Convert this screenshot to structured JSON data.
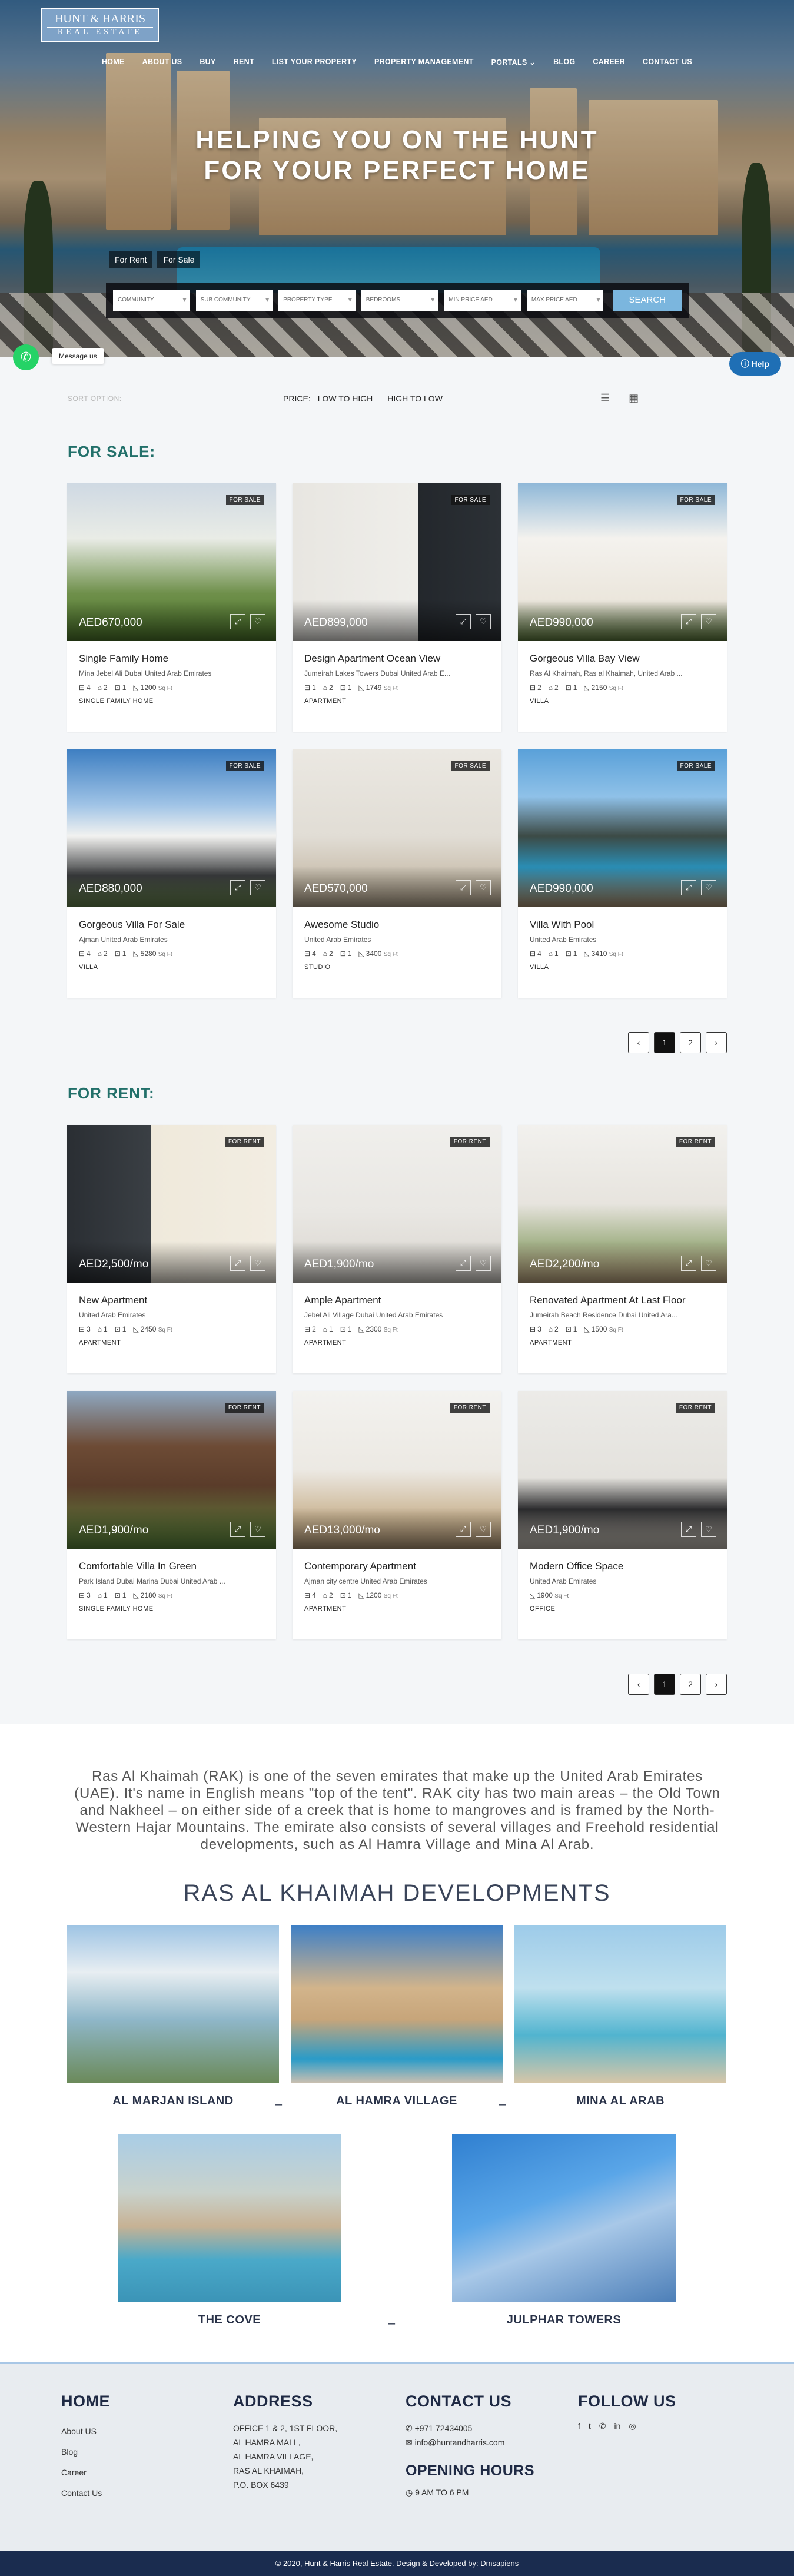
{
  "brand": {
    "line1": "HUNT & HARRIS",
    "line2": "REAL ESTATE"
  },
  "nav": [
    "HOME",
    "ABOUT US",
    "BUY",
    "RENT",
    "LIST YOUR PROPERTY",
    "PROPERTY MANAGEMENT",
    "PORTALS ⌄",
    "BLOG",
    "CAREER",
    "CONTACT US"
  ],
  "hero": {
    "title_line1": "HELPING YOU ON THE HUNT",
    "title_line2": "FOR YOUR PERFECT HOME",
    "tabs": [
      "For Rent",
      "For Sale"
    ],
    "filters": [
      "COMMUNITY",
      "SUB COMMUNITY",
      "PROPERTY TYPE",
      "BEDROOMS",
      "MIN PRICE AED",
      "MAX PRICE AED"
    ],
    "search_label": "SEARCH"
  },
  "widgets": {
    "whatsapp_label": "Message us",
    "help_label": "Help",
    "whatsapp_icon": "whatsapp-icon",
    "help_icon": "question-circle-icon"
  },
  "sort": {
    "label": "SORT OPTION:",
    "price_label": "PRICE:",
    "low_high": "LOW TO HIGH",
    "high_low": "HIGH TO LOW",
    "list_icon": "list-view-icon",
    "grid_icon": "grid-view-icon"
  },
  "sale": {
    "heading": "FOR SALE:",
    "listings": [
      {
        "badge": "FOR SALE",
        "price": "AED670,000",
        "title": "Single Family Home",
        "address": "Mina Jebel Ali Dubai United Arab Emirates",
        "beds": "4",
        "baths": "2",
        "garage": "1",
        "area": "1200",
        "unit": "Sq Ft",
        "type": "SINGLE FAMILY HOME",
        "bg": "linear-gradient(180deg,#cfd9e3 0%,#e9ece6 35%,#6e8f4a 70%,#4f7a2c 100%)"
      },
      {
        "badge": "FOR SALE",
        "price": "AED899,000",
        "title": "Design Apartment Ocean View",
        "address": "Jumeirah Lakes Towers Dubai United Arab E...",
        "beds": "1",
        "baths": "2",
        "garage": "1",
        "area": "1749",
        "unit": "Sq Ft",
        "type": "APARTMENT",
        "bg": "linear-gradient(90deg,#e8e6e1 0%,#efeeea 60%,#23272c 60%,#2c3136 100%)"
      },
      {
        "badge": "FOR SALE",
        "price": "AED990,000",
        "title": "Gorgeous Villa Bay View",
        "address": "Ras Al Khaimah, Ras al Khaimah, United Arab ...",
        "beds": "2",
        "baths": "2",
        "garage": "1",
        "area": "2150",
        "unit": "Sq Ft",
        "type": "VILLA",
        "bg": "linear-gradient(180deg,#8fb8d8 0%,#f4f2ee 35%,#ebe6dc 75%,#5f7d3d 100%)"
      },
      {
        "badge": "FOR SALE",
        "price": "AED880,000",
        "title": "Gorgeous Villa For Sale",
        "address": "Ajman United Arab Emirates",
        "beds": "4",
        "baths": "2",
        "garage": "1",
        "area": "5280",
        "unit": "Sq Ft",
        "type": "VILLA",
        "bg": "linear-gradient(180deg,#3e7fc2 0%,#9fc3e6 35%,#f2f2f0 55%,#3d3f41 80%,#6c8a52 100%)"
      },
      {
        "badge": "FOR SALE",
        "price": "AED570,000",
        "title": "Awesome Studio",
        "address": "United Arab Emirates",
        "beds": "4",
        "baths": "2",
        "garage": "1",
        "area": "3400",
        "unit": "Sq Ft",
        "type": "STUDIO",
        "bg": "linear-gradient(180deg,#ebe8e2 0%,#e1ddd5 55%,#cfc6b7 75%,#b9aa92 100%)"
      },
      {
        "badge": "FOR SALE",
        "price": "AED990,000",
        "title": "Villa With Pool",
        "address": "United Arab Emirates",
        "beds": "4",
        "baths": "1",
        "garage": "1",
        "area": "3410",
        "unit": "Sq Ft",
        "type": "VILLA",
        "bg": "linear-gradient(180deg,#5aa1d9 0%,#8fc1e8 30%,#3c4a45 55%,#2a8fb7 75%,#b79b78 100%)"
      }
    ],
    "pages": [
      "2"
    ]
  },
  "rent": {
    "heading": "FOR RENT:",
    "listings": [
      {
        "badge": "FOR RENT",
        "price": "AED2,500/mo",
        "title": "New Apartment",
        "address": "United Arab Emirates",
        "beds": "3",
        "baths": "1",
        "garage": "1",
        "area": "2450",
        "unit": "Sq Ft",
        "type": "APARTMENT",
        "bg": "linear-gradient(90deg,#2a2e33 0%,#3a3f44 40%,#efe9db 40%,#f2ede2 100%)"
      },
      {
        "badge": "FOR RENT",
        "price": "AED1,900/mo",
        "title": "Ample Apartment",
        "address": "Jebel Ali Village Dubai United Arab Emirates",
        "beds": "2",
        "baths": "1",
        "garage": "1",
        "area": "2300",
        "unit": "Sq Ft",
        "type": "APARTMENT",
        "bg": "linear-gradient(180deg,#f0efec 0%,#e9e7e3 55%,#d8d4cd 100%)"
      },
      {
        "badge": "FOR RENT",
        "price": "AED2,200/mo",
        "title": "Renovated Apartment At Last Floor",
        "address": "Jumeirah Beach Residence Dubai United Ara...",
        "beds": "3",
        "baths": "2",
        "garage": "1",
        "area": "1500",
        "unit": "Sq Ft",
        "type": "APARTMENT",
        "bg": "linear-gradient(180deg,#f2f1ee 0%,#e7e4de 50%,#a5b38a 75%,#c6ad86 100%)"
      },
      {
        "badge": "FOR RENT",
        "price": "AED1,900/mo",
        "title": "Comfortable Villa In Green",
        "address": "Park Island Dubai Marina Dubai United Arab ...",
        "beds": "3",
        "baths": "1",
        "garage": "1",
        "area": "2180",
        "unit": "Sq Ft",
        "type": "SINGLE FAMILY HOME",
        "bg": "linear-gradient(180deg,#8fa9c2 0%,#6d4b35 35%,#5a3c2a 60%,#5f8a3e 100%)"
      },
      {
        "badge": "FOR RENT",
        "price": "AED13,000/mo",
        "title": "Contemporary Apartment",
        "address": "Ajman city centre United Arab Emirates",
        "beds": "4",
        "baths": "2",
        "garage": "1",
        "area": "1200",
        "unit": "Sq Ft",
        "type": "APARTMENT",
        "bg": "linear-gradient(180deg,#f3f2ef 0%,#ece9e3 50%,#cbb594 80%,#b89e7b 100%)"
      },
      {
        "badge": "FOR RENT",
        "price": "AED1,900/mo",
        "title": "Modern Office Space",
        "address": "United Arab Emirates",
        "beds": "",
        "baths": "",
        "garage": "",
        "area": "1900",
        "unit": "Sq Ft",
        "type": "OFFICE",
        "bg": "linear-gradient(180deg,#ecebe8 0%,#e4e2dd 55%,#2c2c2e 75%,#cfc9bf 100%)"
      }
    ],
    "pages": [
      "2"
    ]
  },
  "pager": {
    "prev": "‹",
    "current": "1",
    "next": "›"
  },
  "about": {
    "text": "Ras Al Khaimah (RAK) is one of the seven emirates that make up the United Arab Emirates (UAE). It's name in English means \"top of the tent\". RAK city has two main areas – the Old Town and Nakheel – on either side of a creek that is home to mangroves and is framed by the North-Western Hajar Mountains. The emirate also consists of several villages and Freehold residential developments, such as Al Hamra Village and Mina Al Arab.",
    "heading": "RAS AL KHAIMAH DEVELOPMENTS"
  },
  "developments": [
    {
      "name": "AL MARJAN ISLAND",
      "bg": "linear-gradient(180deg,#9ec4e4 0%,#e8eef2 30%,#8fb7c9 60%,#6b8a5a 100%)"
    },
    {
      "name": "AL HAMRA VILLAGE",
      "bg": "linear-gradient(180deg,#3d7fc6 0%,#d2b48b 40%,#c7a57a 60%,#2a9bc8 85%,#c9bfb1 100%)"
    },
    {
      "name": "MINA AL ARAB",
      "bg": "linear-gradient(180deg,#9dcbe9 0%,#bfe0ee 40%,#51b4cf 70%,#d6c6a8 100%)"
    },
    {
      "name": "THE COVE",
      "bg": "linear-gradient(180deg,#a9cde6 0%,#c9d2cc 35%,#c7b294 55%,#4aa9c9 75%,#3b94b7 100%)"
    },
    {
      "name": "JULPHAR TOWERS",
      "bg": "linear-gradient(160deg,#2f7fd0 0%,#5aa6e8 40%,#a8c8e8 60%,#4d7fb8 100%)"
    }
  ],
  "dash": "–",
  "footer": {
    "home": {
      "heading": "HOME",
      "links": [
        "About US",
        "Blog",
        "Career",
        "Contact Us"
      ]
    },
    "address": {
      "heading": "ADDRESS",
      "lines": [
        "OFFICE 1 & 2, 1ST FLOOR,",
        "AL HAMRA MALL,",
        "AL HAMRA VILLAGE,",
        "RAS AL KHAIMAH,",
        "P.O. BOX 6439"
      ]
    },
    "contact": {
      "heading": "CONTACT US",
      "phone": "+971 72434005",
      "email": "info@huntandharris.com",
      "hours_heading": "OPENING HOURS",
      "hours": "9 AM TO 6 PM",
      "phone_icon": "phone-icon",
      "email_icon": "envelope-icon",
      "clock_icon": "clock-icon"
    },
    "follow": {
      "heading": "FOLLOW US",
      "icons": [
        "facebook-icon",
        "twitter-icon",
        "whatsapp-icon",
        "linkedin-icon",
        "instagram-icon"
      ]
    }
  },
  "copyright": "© 2020, Hunt & Harris Real Estate. Design & Developed by: Dmsapiens"
}
